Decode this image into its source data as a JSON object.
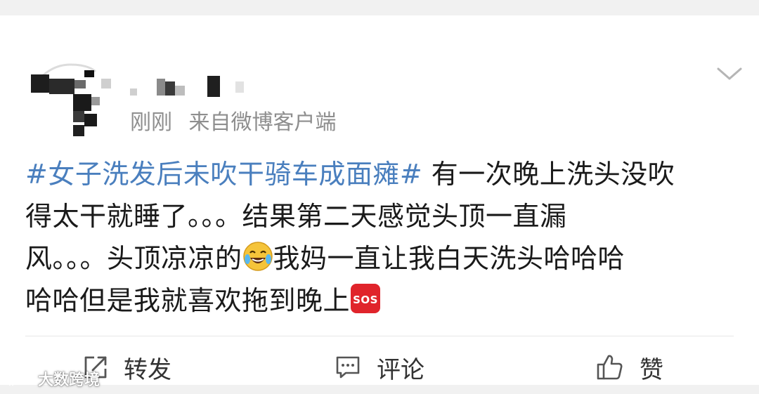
{
  "post": {
    "time": "刚刚",
    "source": "来自微博客户端",
    "topic": "#女子洗发后未吹干骑车成面瘫#",
    "line1_rest": " 有一次晚上洗头没吹",
    "line2": "得太干就睡了。。。结果第二天感觉头顶一直漏",
    "line3_a": "风。。。头顶凉凉的",
    "line3_b": "我妈一直让我白天洗头哈哈哈",
    "line4": "哈哈但是我就喜欢拖到晚上",
    "emoji_1": "laughing-crying-emoji",
    "emoji_2": "sos-emoji"
  },
  "actions": {
    "repost_label": "转发",
    "comment_label": "评论",
    "like_label": "赞"
  },
  "watermark": {
    "text": "大数跨境"
  },
  "colors": {
    "topic": "#4a7fbe",
    "meta": "#8e8e8e",
    "sos": "#e0242b"
  }
}
